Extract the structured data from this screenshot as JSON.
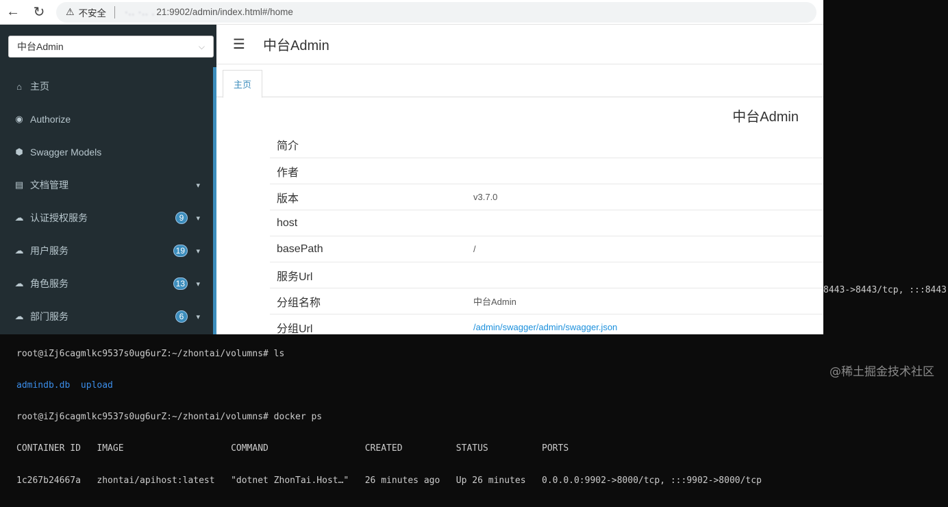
{
  "browser": {
    "insecure_label": "不安全",
    "url_host_blurred": "·.. ·.. .",
    "url": "21:9902/admin/index.html#/home"
  },
  "sidebar": {
    "group_select": "中台Admin",
    "items": [
      {
        "label": "主页",
        "icon": "home-icon",
        "glyph": "⌂"
      },
      {
        "label": "Authorize",
        "icon": "lock-icon",
        "glyph": "🔒"
      },
      {
        "label": "Swagger Models",
        "icon": "cube-icon",
        "glyph": "⬢"
      },
      {
        "label": "文档管理",
        "icon": "file-icon",
        "glyph": "▤"
      },
      {
        "label": "认证授权服务",
        "icon": "cloud-icon",
        "glyph": "☁",
        "badge": "9"
      },
      {
        "label": "用户服务",
        "icon": "cloud-icon",
        "glyph": "☁",
        "badge": "19"
      },
      {
        "label": "角色服务",
        "icon": "cloud-icon",
        "glyph": "☁",
        "badge": "13"
      },
      {
        "label": "部门服务",
        "icon": "cloud-icon",
        "glyph": "☁",
        "badge": "6"
      }
    ]
  },
  "header": {
    "title": "中台Admin"
  },
  "tabs": [
    "主页"
  ],
  "doc": {
    "title": "中台Admin",
    "rows": [
      {
        "label": "简介",
        "value": ""
      },
      {
        "label": "作者",
        "value": ""
      },
      {
        "label": "版本",
        "value": "v3.7.0"
      },
      {
        "label": "host",
        "value": ""
      },
      {
        "label": "basePath",
        "value": "/"
      },
      {
        "label": "服务Url",
        "value": ""
      },
      {
        "label": "分组名称",
        "value": "中台Admin"
      },
      {
        "label": "分组Url",
        "value": "/admin/swagger/admin/swagger.json"
      }
    ]
  },
  "terminal": {
    "right_text": "8443->8443/tcp, :::8443",
    "lines": [
      "root@iZj6cagmlkc9537s0ug6urZ:~/zhontai/volumns# ls",
      "admindb.db  upload",
      "root@iZj6cagmlkc9537s0ug6urZ:~/zhontai/volumns# docker ps",
      "CONTAINER ID   IMAGE                    COMMAND                  CREATED          STATUS          PORTS",
      "1c267b24667a   zhontai/apihost:latest   \"dotnet ZhonTai.Host…\"   26 minutes ago   Up 26 minutes   0.0.0.0:9902->8000/tcp, :::9902->8000/tcp"
    ]
  },
  "watermark": "@稀土掘金技术社区",
  "colors": {
    "sidebar_bg": "#222d32",
    "accent": "#3c8dbc",
    "link": "#1a8fdc"
  }
}
